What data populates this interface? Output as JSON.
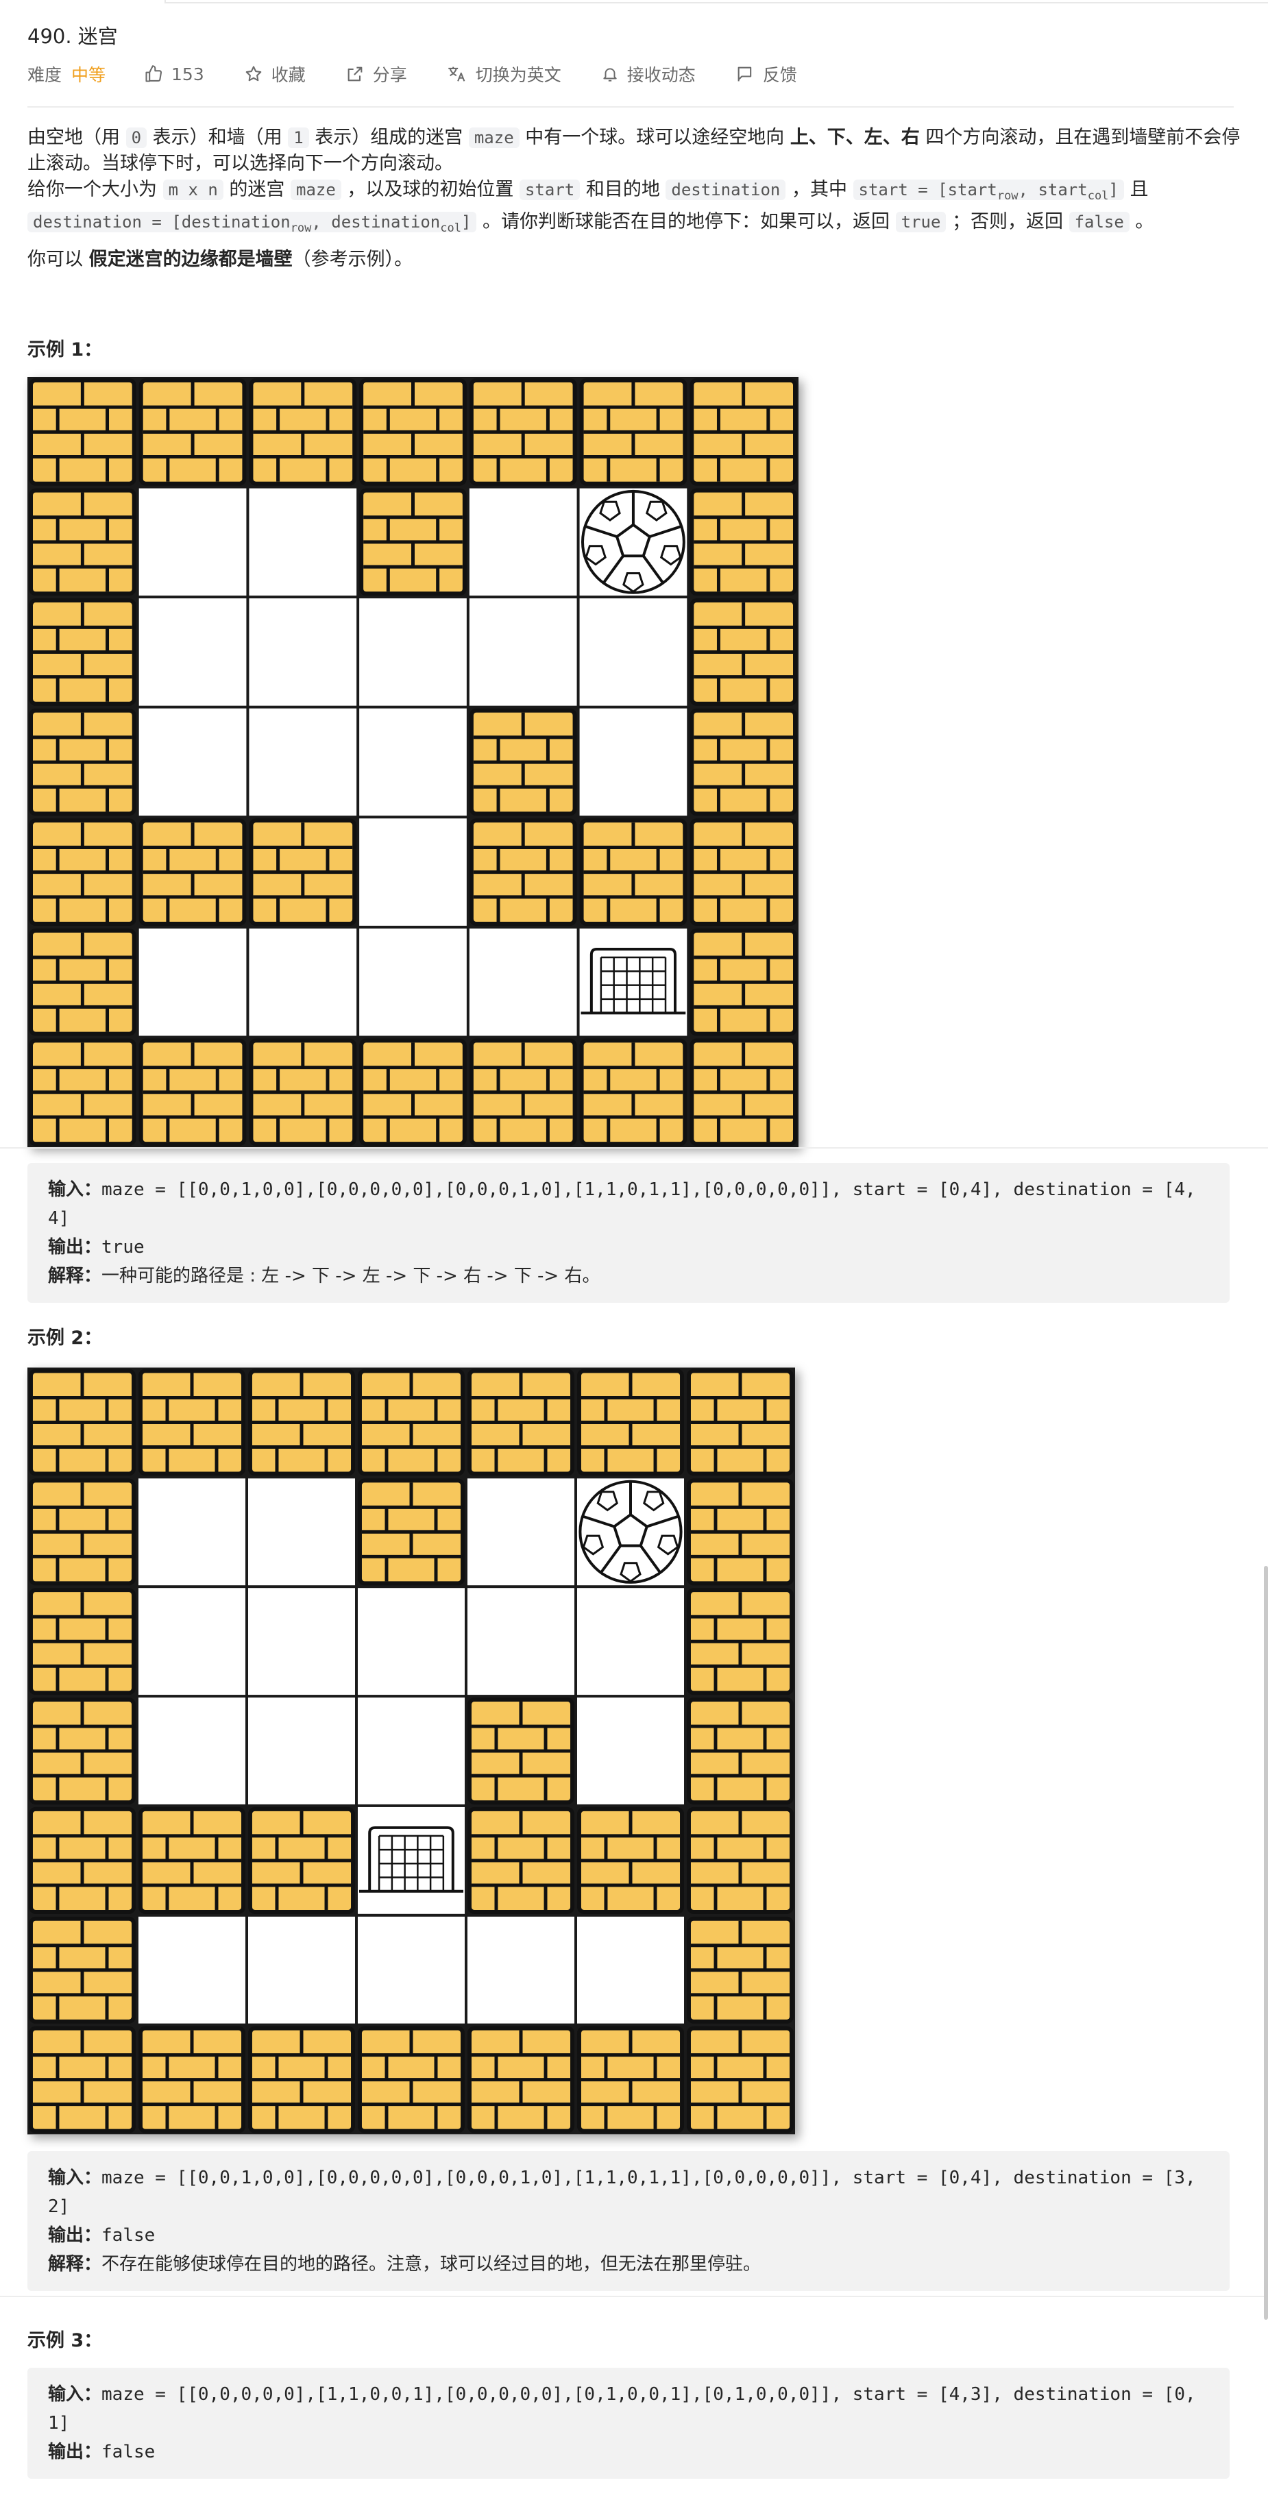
{
  "problem": {
    "title": "490. 迷宫",
    "difficulty_label": "难度",
    "difficulty": "中等",
    "likes": "153",
    "favorite": "收藏",
    "share": "分享",
    "switch_lang": "切换为英文",
    "subscribe": "接收动态",
    "feedback": "反馈"
  },
  "desc": {
    "p1_a": "由空地（用 ",
    "p1_code0": "0",
    "p1_b": " 表示）和墙（用 ",
    "p1_code1": "1",
    "p1_c": " 表示）组成的迷宫 ",
    "p1_maze": "maze",
    "p1_d": " 中有一个球。球可以途经空地向 ",
    "p1_up": "上、下、左、右",
    "p1_e": " 四个方向滚动，且在遇到墙壁前不会停止滚动。当球停下时，可以选择向下一个方向滚动。",
    "p2_a": "给你一个大小为 ",
    "p2_mxn": "m x n",
    "p2_b": " 的迷宫 ",
    "p2_maze": "maze",
    "p2_c": " ，以及球的初始位置 ",
    "p2_start": "start",
    "p2_d": " 和目的地 ",
    "p2_dest": "destination",
    "p2_e": " ，其中 ",
    "p2_start_eq": "start = [start",
    "p2_row": "row",
    "p2_comma": ", start",
    "p2_col": "col",
    "p2_close": "]",
    "p2_f": " 且",
    "p3_dest_eq": "destination = [destination",
    "p3_row": "row",
    "p3_comma": ", destination",
    "p3_col": "col",
    "p3_close": "]",
    "p3_a": " 。请你判断球能否在目的地停下：如果可以，返回 ",
    "p3_true": "true",
    "p3_b": " ；否则，返回 ",
    "p3_false": "false",
    "p3_c": " 。",
    "p4_a": "你可以 ",
    "p4_bold": "假定迷宫的边缘都是墙壁",
    "p4_b": "（参考示例）。"
  },
  "examples": [
    {
      "title": "示例 1：",
      "input_label": "输入：",
      "input": "maze = [[0,0,1,0,0],[0,0,0,0,0],[0,0,0,1,0],[1,1,0,1,1],[0,0,0,0,0]], start = [0,4], destination = [4,4]",
      "output_label": "输出：",
      "output": "true",
      "explain_label": "解释：",
      "explain": "一种可能的路径是 : 左 -> 下 -> 左 -> 下 -> 右 -> 下 -> 右。",
      "maze": [
        [
          0,
          0,
          1,
          0,
          0
        ],
        [
          0,
          0,
          0,
          0,
          0
        ],
        [
          0,
          0,
          0,
          1,
          0
        ],
        [
          1,
          1,
          0,
          1,
          1
        ],
        [
          0,
          0,
          0,
          0,
          0
        ]
      ],
      "ball": [
        0,
        4
      ],
      "goal": [
        4,
        4
      ]
    },
    {
      "title": "示例 2：",
      "input_label": "输入：",
      "input": "maze = [[0,0,1,0,0],[0,0,0,0,0],[0,0,0,1,0],[1,1,0,1,1],[0,0,0,0,0]], start = [0,4], destination = [3,2]",
      "output_label": "输出：",
      "output": "false",
      "explain_label": "解释：",
      "explain": "不存在能够使球停在目的地的路径。注意，球可以经过目的地，但无法在那里停驻。",
      "maze": [
        [
          0,
          0,
          1,
          0,
          0
        ],
        [
          0,
          0,
          0,
          0,
          0
        ],
        [
          0,
          0,
          0,
          1,
          0
        ],
        [
          1,
          1,
          0,
          1,
          1
        ],
        [
          0,
          0,
          0,
          0,
          0
        ]
      ],
      "ball": [
        0,
        4
      ],
      "goal": [
        3,
        2
      ]
    },
    {
      "title": "示例 3：",
      "input_label": "输入：",
      "input": "maze = [[0,0,0,0,0],[1,1,0,0,1],[0,0,0,0,0],[0,1,0,0,1],[0,1,0,0,0]], start = [4,3], destination = [0,1]",
      "output_label": "输出：",
      "output": "false"
    }
  ],
  "colors": {
    "brick": "#f7c75c",
    "mortar": "#111111",
    "difficulty": "#f0a020"
  }
}
